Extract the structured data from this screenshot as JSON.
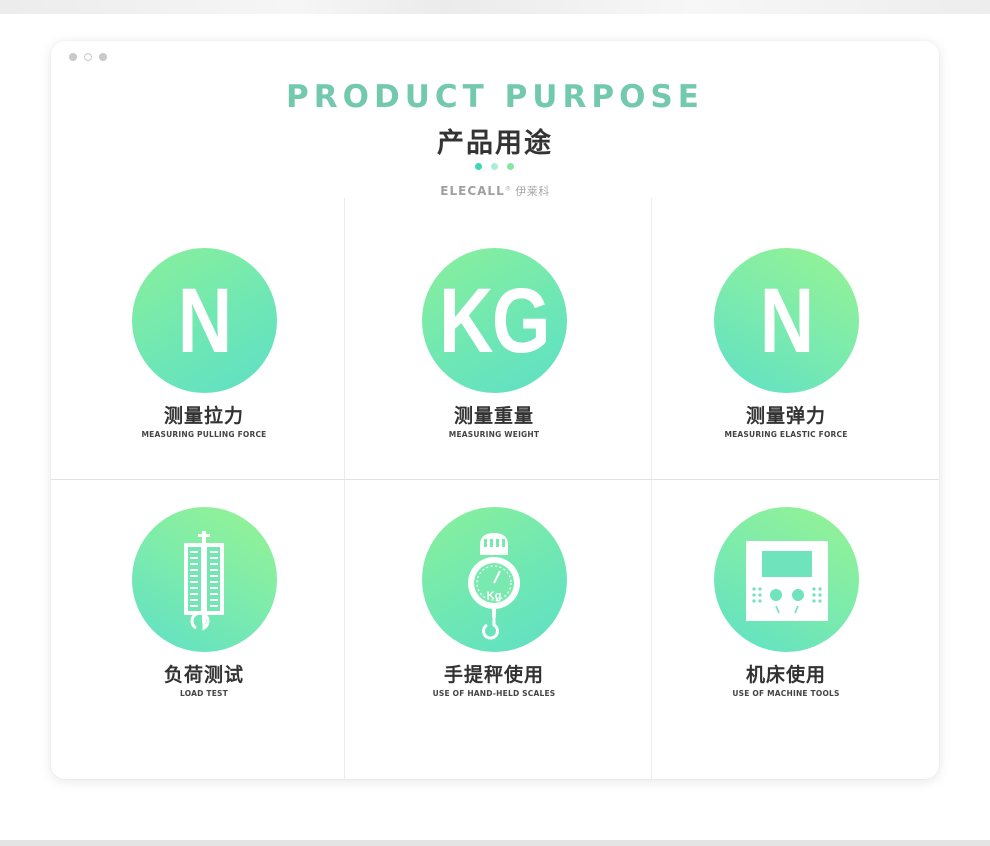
{
  "header": {
    "title_en": "PRODUCT PURPOSE",
    "title_cn": "产品用途",
    "brand_en": "ELECALL",
    "brand_reg": "®",
    "brand_cn": "伊莱科"
  },
  "colors": {
    "accent": "#72c9ae",
    "gradient_green": "#8af09a",
    "gradient_teal": "#5ee0c6",
    "dot_1": "#3dd6b4",
    "dot_2": "#a8eed8",
    "dot_3": "#86e6a2"
  },
  "items": [
    {
      "icon_text": "N",
      "icon": "letter-n",
      "title_cn": "测量拉力",
      "title_en": "MEASURING PULLING FORCE"
    },
    {
      "icon_text": "KG",
      "icon": "letters-kg",
      "title_cn": "测量重量",
      "title_en": "MEASURING WEIGHT"
    },
    {
      "icon_text": "N",
      "icon": "letter-n",
      "title_cn": "测量弹力",
      "title_en": "MEASURING ELASTIC FORCE"
    },
    {
      "icon": "spring-scale-icon",
      "title_cn": "负荷测试",
      "title_en": "LOAD TEST"
    },
    {
      "icon": "hanging-scale-icon",
      "icon_text": "Kg",
      "title_cn": "手提秤使用",
      "title_en": "USE OF HAND-HELD SCALES"
    },
    {
      "icon": "machine-panel-icon",
      "title_cn": "机床使用",
      "title_en": "USE OF MACHINE TOOLS"
    }
  ]
}
